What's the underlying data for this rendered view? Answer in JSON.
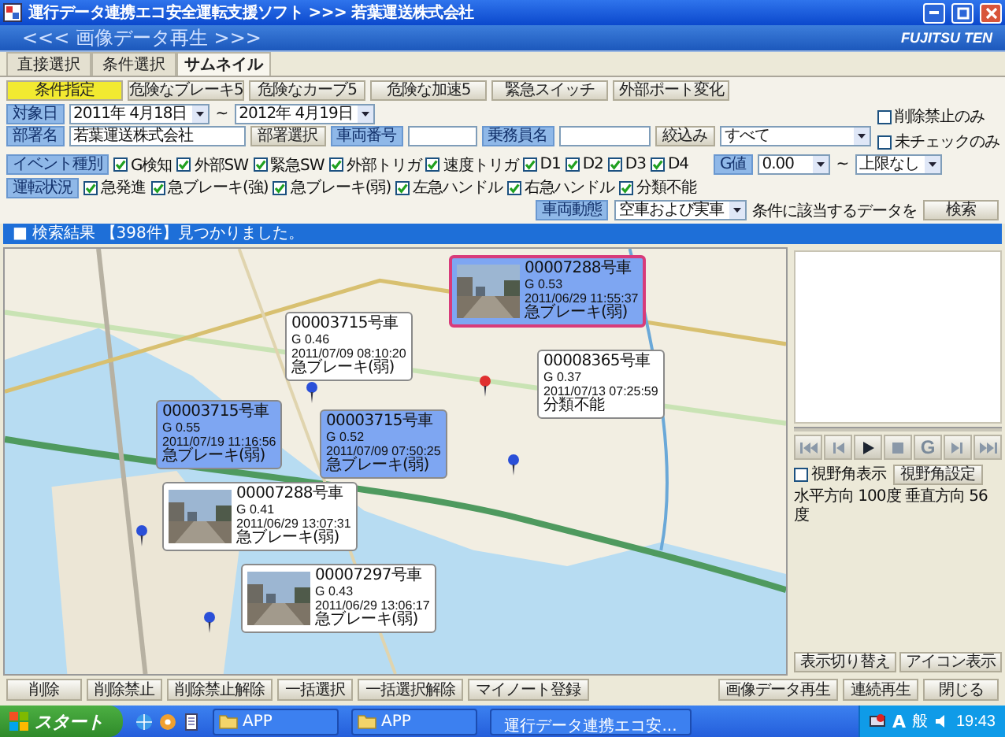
{
  "window": {
    "title": "運行データ連携エコ安全運転支援ソフト >>> 若葉運送株式会社"
  },
  "header": {
    "title": "<<< 画像データ再生 >>>",
    "logo": "FUJITSU TEN"
  },
  "tabs": [
    {
      "label": "直接選択",
      "selected": false
    },
    {
      "label": "条件選択",
      "selected": false
    },
    {
      "label": "サムネイル",
      "selected": true
    }
  ],
  "presets": [
    {
      "label": "条件指定",
      "selected": true
    },
    {
      "label": "危険なブレーキ5",
      "selected": false
    },
    {
      "label": "危険なカーブ5",
      "selected": false
    },
    {
      "label": "危険な加速5",
      "selected": false
    },
    {
      "label": "緊急スイッチ",
      "selected": false
    },
    {
      "label": "外部ポート変化",
      "selected": false
    }
  ],
  "filters": {
    "date": {
      "label": "対象日",
      "from": "2011年 4月18日",
      "separator": "~",
      "to": "2012年 4月19日"
    },
    "flags": [
      {
        "label": "削除禁止のみ",
        "checked": false
      },
      {
        "label": "未チェックのみ",
        "checked": false
      }
    ],
    "department": {
      "label": "部署名",
      "value": "若葉運送株式会社",
      "button": "部署選択"
    },
    "vehicle": {
      "label": "車両番号"
    },
    "driver": {
      "label": "乗務員名"
    },
    "narrow": {
      "button": "絞込み",
      "value": "すべて"
    },
    "event_types": {
      "label": "イベント種別",
      "items": [
        {
          "label": "G検知",
          "checked": true
        },
        {
          "label": "外部SW",
          "checked": true
        },
        {
          "label": "緊急SW",
          "checked": true
        },
        {
          "label": "外部トリガ",
          "checked": true
        },
        {
          "label": "速度トリガ",
          "checked": true
        },
        {
          "label": "D1",
          "checked": true
        },
        {
          "label": "D2",
          "checked": true
        },
        {
          "label": "D3",
          "checked": true
        },
        {
          "label": "D4",
          "checked": true
        }
      ]
    },
    "g_value": {
      "label": "G値",
      "from": "0.00",
      "separator": "~",
      "to": "上限なし"
    },
    "driving": {
      "label": "運転状況",
      "items": [
        {
          "label": "急発進",
          "checked": true
        },
        {
          "label": "急ブレーキ(強)",
          "checked": true
        },
        {
          "label": "急ブレーキ(弱)",
          "checked": true
        },
        {
          "label": "左急ハンドル",
          "checked": true
        },
        {
          "label": "右急ハンドル",
          "checked": true
        },
        {
          "label": "分類不能",
          "checked": true
        }
      ]
    },
    "vehicle_state": {
      "label": "車両動態",
      "value": "空車および実車"
    },
    "search_hint": "条件に該当するデータを",
    "search_button": "検索"
  },
  "result": "■ 検索結果 【398件】見つかりました。",
  "callouts": [
    {
      "vehicle": "00007288号車",
      "g": "G 0.53",
      "time": "2011/06/29 11:55:37",
      "event": "急ブレーキ(弱)",
      "kind": "blue",
      "thumbnail": true,
      "selected": true
    },
    {
      "vehicle": "00003715号車",
      "g": "G 0.46",
      "time": "2011/07/09 08:10:20",
      "event": "急ブレーキ(弱)",
      "kind": "white",
      "thumbnail": false,
      "selected": false
    },
    {
      "vehicle": "00008365号車",
      "g": "G 0.37",
      "time": "2011/07/13 07:25:59",
      "event": "分類不能",
      "kind": "white",
      "thumbnail": false,
      "selected": false
    },
    {
      "vehicle": "00003715号車",
      "g": "G 0.55",
      "time": "2011/07/19 11:16:56",
      "event": "急ブレーキ(弱)",
      "kind": "blue",
      "thumbnail": false,
      "selected": false
    },
    {
      "vehicle": "00003715号車",
      "g": "G 0.52",
      "time": "2011/07/09 07:50:25",
      "event": "急ブレーキ(弱)",
      "kind": "blue",
      "thumbnail": false,
      "selected": false
    },
    {
      "vehicle": "00007288号車",
      "g": "G 0.41",
      "time": "2011/06/29 13:07:31",
      "event": "急ブレーキ(弱)",
      "kind": "white",
      "thumbnail": true,
      "selected": false
    },
    {
      "vehicle": "00007297号車",
      "g": "G 0.43",
      "time": "2011/06/29 13:06:17",
      "event": "急ブレーキ(弱)",
      "kind": "white",
      "thumbnail": true,
      "selected": false
    }
  ],
  "player": {
    "g_button": "G",
    "view_angle": {
      "label": "視野角表示",
      "checked": false
    },
    "view_setting": "視野角設定",
    "angle_text": "水平方向 100度 垂直方向 56度",
    "buttons": [
      "表示切り替え",
      "アイコン表示"
    ]
  },
  "actions": [
    "削除",
    "削除禁止",
    "削除禁止解除",
    "一括選択",
    "一括選択解除",
    "マイノート登録"
  ],
  "playback_actions": [
    "画像データ再生",
    "連続再生",
    "閉じる"
  ],
  "taskbar": {
    "start": "スタート",
    "tasks": [
      {
        "label": "APP",
        "kind": "folder"
      },
      {
        "label": "APP",
        "kind": "folder"
      },
      {
        "label": "運行データ連携エコ安...",
        "kind": "app"
      }
    ],
    "ime": [
      "A",
      "般"
    ],
    "clock": "19:43"
  }
}
